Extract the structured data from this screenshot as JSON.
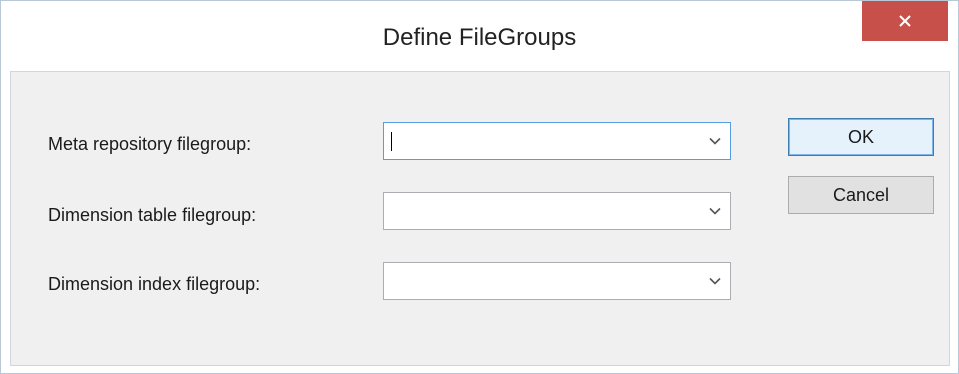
{
  "window": {
    "title": "Define FileGroups"
  },
  "form": {
    "meta_label": "Meta repository filegroup:",
    "meta_value": "",
    "dim_table_label": "Dimension table filegroup:",
    "dim_table_value": "",
    "dim_index_label": "Dimension index filegroup:",
    "dim_index_value": ""
  },
  "buttons": {
    "ok_label": "OK",
    "cancel_label": "Cancel"
  },
  "icons": {
    "close": "close-icon",
    "dropdown": "chevron-down-icon"
  },
  "colors": {
    "close_button": "#c7504b",
    "dialog_background": "#f0f0f0",
    "focus_border": "#569de5"
  }
}
